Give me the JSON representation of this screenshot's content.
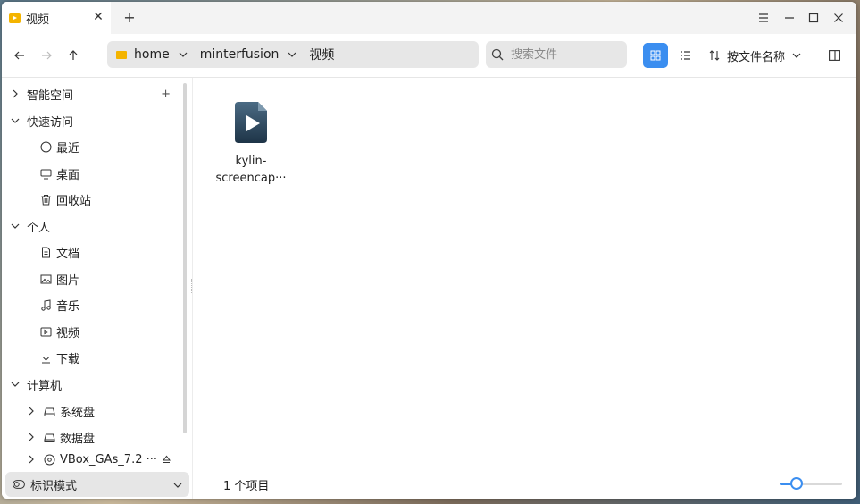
{
  "tab": {
    "title": "视频",
    "icon": "video-folder-icon"
  },
  "window_controls": [
    "menu-icon",
    "minimize-icon",
    "maximize-icon",
    "close-icon"
  ],
  "navigation": {
    "back": "arrow-left-icon",
    "forward": "arrow-right-icon",
    "up": "arrow-up-icon"
  },
  "breadcrumb": [
    {
      "label": "home"
    },
    {
      "label": "minterfusion"
    },
    {
      "label": "视频"
    }
  ],
  "search": {
    "placeholder": "搜索文件",
    "value": ""
  },
  "view": {
    "mode": "grid"
  },
  "sort": {
    "label": "按文件名称"
  },
  "sidebar": {
    "sections": [
      {
        "label": "智能空间",
        "expanded": false,
        "add": "+"
      },
      {
        "label": "快速访问",
        "expanded": true,
        "items": [
          {
            "label": "最近",
            "icon": "clock-icon"
          },
          {
            "label": "桌面",
            "icon": "monitor-icon"
          },
          {
            "label": "回收站",
            "icon": "trash-icon"
          }
        ]
      },
      {
        "label": "个人",
        "expanded": true,
        "items": [
          {
            "label": "文档",
            "icon": "document-icon"
          },
          {
            "label": "图片",
            "icon": "image-icon"
          },
          {
            "label": "音乐",
            "icon": "music-icon"
          },
          {
            "label": "视频",
            "icon": "video-icon"
          },
          {
            "label": "下载",
            "icon": "download-icon"
          }
        ]
      },
      {
        "label": "计算机",
        "expanded": true,
        "items": [
          {
            "label": "系统盘",
            "icon": "drive-icon"
          },
          {
            "label": "数据盘",
            "icon": "drive-icon"
          },
          {
            "label": "VBox_GAs_7.2 ···",
            "icon": "disc-icon"
          }
        ]
      }
    ],
    "mode_label": "标识模式"
  },
  "files": [
    {
      "name_line1": "kylin-",
      "name_line2": "screencap···",
      "icon": "video-file-icon"
    }
  ],
  "status": {
    "count": "1 个项目"
  },
  "zoom": {
    "level": 0.25
  },
  "colors": {
    "accent": "#3b8ef0",
    "folder": "#f4b400"
  }
}
